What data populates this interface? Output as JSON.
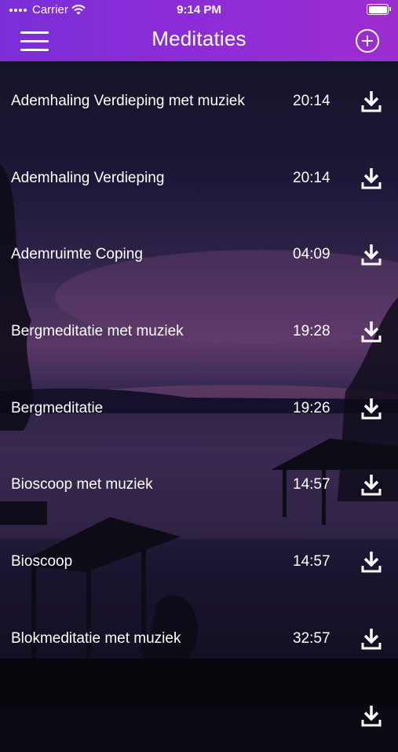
{
  "status_bar": {
    "carrier": "Carrier",
    "time": "9:14 PM"
  },
  "header": {
    "title": "Meditaties",
    "menu_icon": "hamburger-icon",
    "add_icon": "plus-circle-icon"
  },
  "colors": {
    "header_start": "#7a2fd6",
    "header_end": "#9d2dd0",
    "text": "#ffffff"
  },
  "meditations": [
    {
      "title": "Ademhaling Verdieping met muziek",
      "duration": "20:14"
    },
    {
      "title": "Ademhaling Verdieping",
      "duration": "20:14"
    },
    {
      "title": "Ademruimte Coping",
      "duration": "04:09"
    },
    {
      "title": "Bergmeditatie met muziek",
      "duration": "19:28"
    },
    {
      "title": "Bergmeditatie",
      "duration": "19:26"
    },
    {
      "title": "Bioscoop met muziek",
      "duration": "14:57"
    },
    {
      "title": "Bioscoop",
      "duration": "14:57"
    },
    {
      "title": "Blokmeditatie met muziek",
      "duration": "32:57"
    },
    {
      "title": "",
      "duration": ""
    }
  ]
}
